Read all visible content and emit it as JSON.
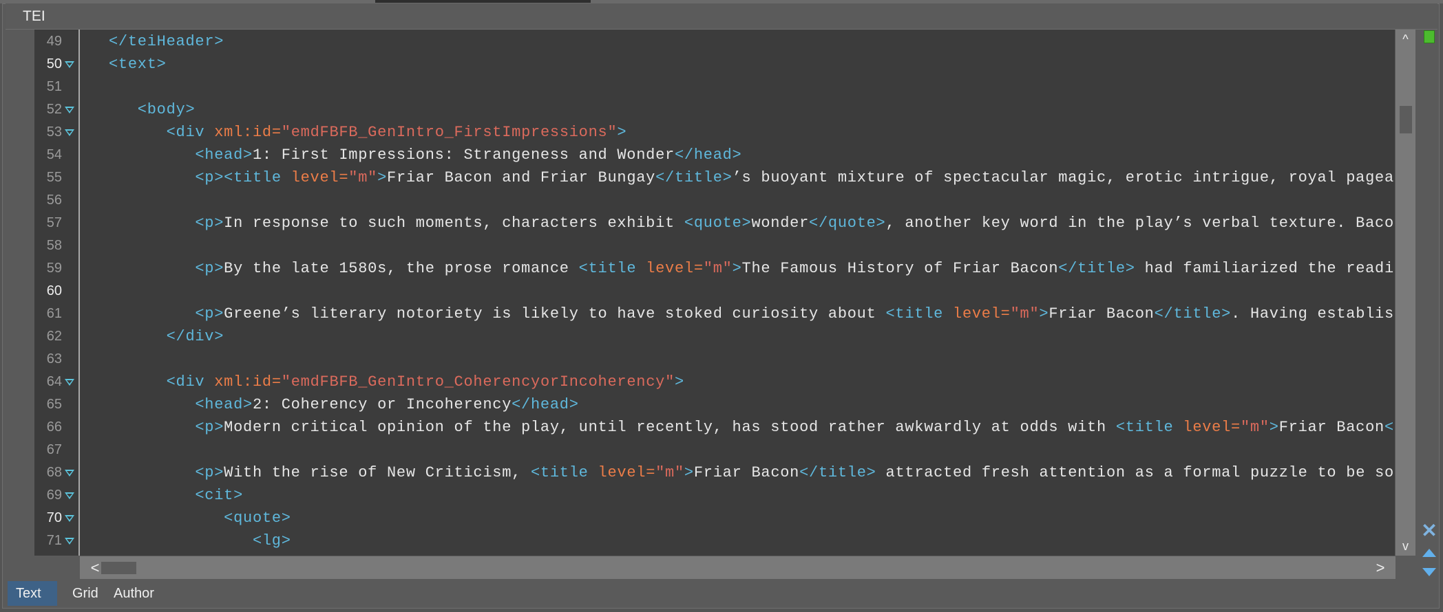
{
  "header": {
    "title": "TEI"
  },
  "colors": {
    "tag": "#5fb8dc",
    "attr_name": "#ec7d48",
    "attr_value": "#db6a5c",
    "text": "#e6e6e6",
    "status_ok": "#4cbb2e",
    "active_tab": "#3e6287"
  },
  "icons": {
    "fold": "fold-triangle-icon",
    "scroll_up": "chevron-up-icon",
    "scroll_down": "chevron-down-icon",
    "scroll_left": "chevron-left-icon",
    "scroll_right": "chevron-right-icon",
    "close": "close-x-icon",
    "prev": "arrow-up-icon",
    "next": "arrow-down-icon",
    "status": "status-green-icon"
  },
  "scroll": {
    "vertical_arrow_up": "^",
    "vertical_arrow_down": "v",
    "horizontal_arrow_left": "<",
    "horizontal_arrow_right": ">",
    "close_glyph": "✕"
  },
  "editor": {
    "lines": [
      {
        "num": "49",
        "level": 0,
        "fold": false,
        "current": false,
        "segs": [
          [
            "t",
            "</teiHeader>"
          ]
        ]
      },
      {
        "num": "50",
        "level": 0,
        "fold": true,
        "current": true,
        "segs": [
          [
            "t",
            "<text>"
          ]
        ]
      },
      {
        "num": "51",
        "level": 0,
        "fold": false,
        "current": false,
        "segs": []
      },
      {
        "num": "52",
        "level": 1,
        "fold": true,
        "current": false,
        "segs": [
          [
            "t",
            "<body>"
          ]
        ]
      },
      {
        "num": "53",
        "level": 2,
        "fold": true,
        "current": false,
        "segs": [
          [
            "t",
            "<div "
          ],
          [
            "a",
            "xml:id="
          ],
          [
            "v",
            "\"emdFBFB_GenIntro_FirstImpressions\""
          ],
          [
            "t",
            ">"
          ]
        ]
      },
      {
        "num": "54",
        "level": 3,
        "fold": false,
        "current": false,
        "segs": [
          [
            "t",
            "<head>"
          ],
          [
            "x",
            "1: First Impressions: Strangeness and Wonder"
          ],
          [
            "t",
            "</head>"
          ]
        ]
      },
      {
        "num": "55",
        "level": 3,
        "fold": false,
        "current": false,
        "segs": [
          [
            "t",
            "<p><title "
          ],
          [
            "a",
            "level="
          ],
          [
            "v",
            "\"m\""
          ],
          [
            "t",
            ">"
          ],
          [
            "x",
            "Friar Bacon and Friar Bungay"
          ],
          [
            "t",
            "</title>"
          ],
          [
            "x",
            "’s buoyant mixture of spectacular magic, erotic intrigue, royal pagea"
          ]
        ]
      },
      {
        "num": "56",
        "level": 3,
        "fold": false,
        "current": false,
        "segs": []
      },
      {
        "num": "57",
        "level": 3,
        "fold": false,
        "current": false,
        "segs": [
          [
            "t",
            "<p>"
          ],
          [
            "x",
            "In response to such moments, characters exhibit "
          ],
          [
            "t",
            "<quote>"
          ],
          [
            "x",
            "wonder"
          ],
          [
            "t",
            "</quote>"
          ],
          [
            "x",
            ", another key word in the play’s verbal texture. Baco"
          ]
        ]
      },
      {
        "num": "58",
        "level": 3,
        "fold": false,
        "current": false,
        "segs": []
      },
      {
        "num": "59",
        "level": 3,
        "fold": false,
        "current": false,
        "segs": [
          [
            "t",
            "<p>"
          ],
          [
            "x",
            "By the late 1580s, the prose romance "
          ],
          [
            "t",
            "<title "
          ],
          [
            "a",
            "level="
          ],
          [
            "v",
            "\"m\""
          ],
          [
            "t",
            ">"
          ],
          [
            "x",
            "The Famous History of Friar Bacon"
          ],
          [
            "t",
            "</title>"
          ],
          [
            "x",
            " had familiarized the readi"
          ]
        ]
      },
      {
        "num": "60",
        "level": 3,
        "fold": false,
        "current": true,
        "segs": []
      },
      {
        "num": "61",
        "level": 3,
        "fold": false,
        "current": false,
        "segs": [
          [
            "t",
            "<p>"
          ],
          [
            "x",
            "Greene’s literary notoriety is likely to have stoked curiosity about "
          ],
          [
            "t",
            "<title "
          ],
          [
            "a",
            "level="
          ],
          [
            "v",
            "\"m\""
          ],
          [
            "t",
            ">"
          ],
          [
            "x",
            "Friar Bacon"
          ],
          [
            "t",
            "</title>"
          ],
          [
            "x",
            ". Having establis"
          ]
        ]
      },
      {
        "num": "62",
        "level": 2,
        "fold": false,
        "current": false,
        "segs": [
          [
            "t",
            "</div>"
          ]
        ]
      },
      {
        "num": "63",
        "level": 2,
        "fold": false,
        "current": false,
        "segs": []
      },
      {
        "num": "64",
        "level": 2,
        "fold": true,
        "current": false,
        "segs": [
          [
            "t",
            "<div "
          ],
          [
            "a",
            "xml:id="
          ],
          [
            "v",
            "\"emdFBFB_GenIntro_CoherencyorIncoherency\""
          ],
          [
            "t",
            ">"
          ]
        ]
      },
      {
        "num": "65",
        "level": 3,
        "fold": false,
        "current": false,
        "segs": [
          [
            "t",
            "<head>"
          ],
          [
            "x",
            "2: Coherency or Incoherency"
          ],
          [
            "t",
            "</head>"
          ]
        ]
      },
      {
        "num": "66",
        "level": 3,
        "fold": false,
        "current": false,
        "segs": [
          [
            "t",
            "<p>"
          ],
          [
            "x",
            "Modern critical opinion of the play, until recently, has stood rather awkwardly at odds with "
          ],
          [
            "t",
            "<title "
          ],
          [
            "a",
            "level="
          ],
          [
            "v",
            "\"m\""
          ],
          [
            "t",
            ">"
          ],
          [
            "x",
            "Friar Bacon"
          ],
          [
            "t",
            "<"
          ]
        ]
      },
      {
        "num": "67",
        "level": 3,
        "fold": false,
        "current": false,
        "segs": []
      },
      {
        "num": "68",
        "level": 3,
        "fold": true,
        "current": false,
        "segs": [
          [
            "t",
            "<p>"
          ],
          [
            "x",
            "With the rise of New Criticism, "
          ],
          [
            "t",
            "<title "
          ],
          [
            "a",
            "level="
          ],
          [
            "v",
            "\"m\""
          ],
          [
            "t",
            ">"
          ],
          [
            "x",
            "Friar Bacon"
          ],
          [
            "t",
            "</title>"
          ],
          [
            "x",
            " attracted fresh attention as a formal puzzle to be so"
          ]
        ]
      },
      {
        "num": "69",
        "level": 3,
        "fold": true,
        "current": false,
        "segs": [
          [
            "t",
            "<cit>"
          ]
        ]
      },
      {
        "num": "70",
        "level": 4,
        "fold": true,
        "current": true,
        "segs": [
          [
            "t",
            "<quote>"
          ]
        ]
      },
      {
        "num": "71",
        "level": 5,
        "fold": true,
        "current": false,
        "segs": [
          [
            "t",
            "<lg>"
          ]
        ]
      }
    ]
  },
  "bottom_tabs": [
    {
      "label": "Text",
      "active": true
    },
    {
      "label": "Grid",
      "active": false
    },
    {
      "label": "Author",
      "active": false
    }
  ]
}
